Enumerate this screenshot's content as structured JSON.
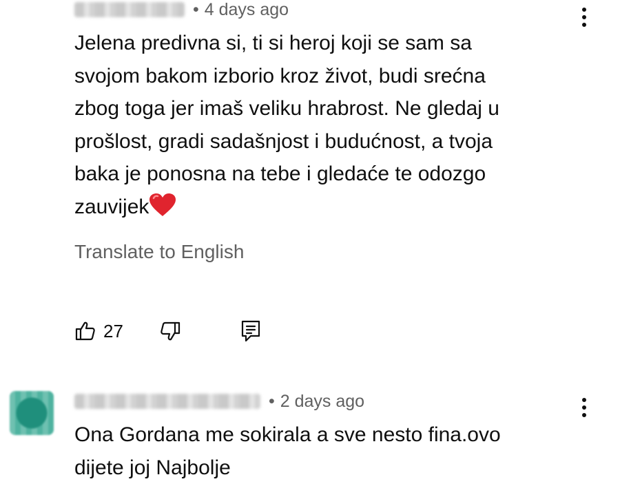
{
  "comments": [
    {
      "time": "4 days ago",
      "separator": "•",
      "text": "Jelena predivna si, ti si heroj koji se sam sa\nsvojom bakom izborio kroz život, budi srećna\nzbog toga jer imaš veliku hrabrost. Ne gledaj u\nprošlost, gradi sadašnjost i budućnost, a tvoja\nbaka je ponosna na tebe i gledaće te odozgo\nzauvijek",
      "emoji": "heart",
      "translate_label": "Translate to English",
      "likes": "27",
      "icons": {
        "like": "thumbs-up-icon",
        "dislike": "thumbs-down-icon",
        "reply": "reply-comment-icon",
        "more": "more-vertical-icon"
      }
    },
    {
      "time": "2 days ago",
      "separator": "•",
      "text": "Ona Gordana me sokirala a sve nesto fina.ovo\ndijete joj Najbolje",
      "avatar_color": "#2a9d88",
      "icons": {
        "more": "more-vertical-icon"
      }
    }
  ]
}
